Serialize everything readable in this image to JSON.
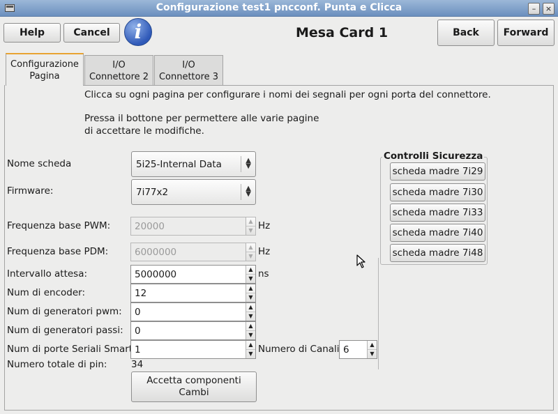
{
  "window": {
    "title": "Configurazione test1 pncconf. Punta e Clicca",
    "minimize_glyph": "–",
    "close_glyph": "×"
  },
  "toolbar": {
    "help_label": "Help",
    "cancel_label": "Cancel",
    "info_glyph": "i",
    "page_title": "Mesa Card 1",
    "back_label": "Back",
    "forward_label": "Forward"
  },
  "tabs": [
    {
      "line1": "Configurazione",
      "line2": "Pagina"
    },
    {
      "line1": "I/O",
      "line2": "Connettore 2"
    },
    {
      "line1": "I/O",
      "line2": "Connettore 3"
    }
  ],
  "intro": {
    "line1": "Clicca su ogni pagina per configurare i nomi dei segnali per ogni porta del connettore.",
    "line2": "Pressa il bottone per permettere alle varie pagine",
    "line3": "di accettare le modifiche."
  },
  "board": {
    "label": "Nome scheda",
    "value": "5i25-Internal Data"
  },
  "firmware": {
    "label": "Firmware:",
    "value": "7i77x2"
  },
  "pwm_base": {
    "label": "Frequenza base PWM:",
    "value": "20000",
    "unit": "Hz"
  },
  "pdm_base": {
    "label": "Frequenza base PDM:",
    "value": "6000000",
    "unit": "Hz"
  },
  "watchdog": {
    "label": "Intervallo attesa:",
    "value": "5000000",
    "unit": "ns"
  },
  "encoders": {
    "label": "Num di encoder:",
    "value": "12"
  },
  "pwm_gens": {
    "label": "Num di generatori pwm:",
    "value": "0"
  },
  "step_gens": {
    "label": "Num di generatori passi:",
    "value": "0"
  },
  "smart_serial": {
    "label": "Num di porte Seriali Smart:",
    "value": "1",
    "channels_label": "Numero di Canali:",
    "channels_value": "6"
  },
  "total_pins": {
    "label": "Numero totale di pin:",
    "value": "34"
  },
  "safety": {
    "title": "Controlli Sicurezza",
    "buttons": [
      "scheda madre 7i29",
      "scheda madre 7i30",
      "scheda madre 7i33",
      "scheda madre 7i40",
      "scheda madre 7i48"
    ]
  },
  "accept": {
    "line1": "Accetta  componenti",
    "line2": "Cambi"
  },
  "arrows": {
    "up": "▲",
    "down": "▼"
  }
}
